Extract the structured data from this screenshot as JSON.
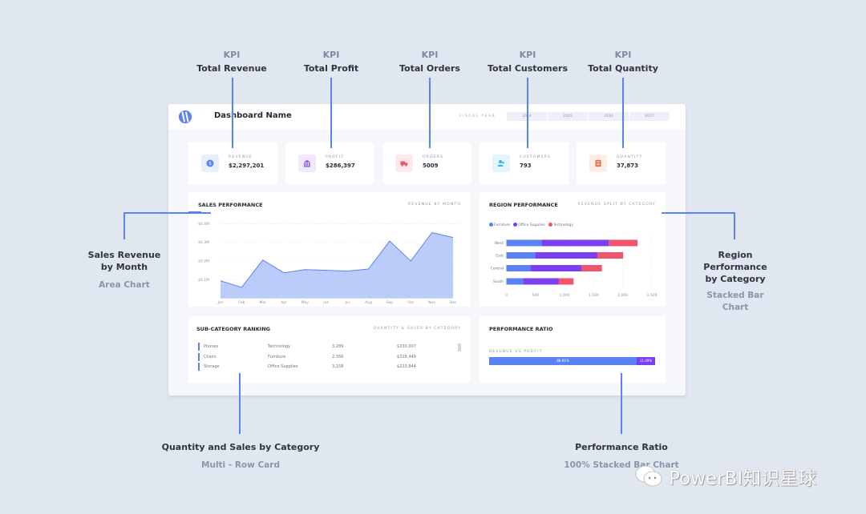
{
  "annotations": {
    "kpis": [
      {
        "tag": "KPI",
        "title": "Total Revenue"
      },
      {
        "tag": "KPI",
        "title": "Total Profit"
      },
      {
        "tag": "KPI",
        "title": "Total Orders"
      },
      {
        "tag": "KPI",
        "title": "Total Customers"
      },
      {
        "tag": "KPI",
        "title": "Total Quantity"
      }
    ],
    "sales": {
      "line1": "Sales Revenue",
      "line2": "by Month",
      "type": "Area Chart"
    },
    "region": {
      "line1": "Region",
      "line2": "Performance",
      "line3": "by Category",
      "type1": "Stacked Bar",
      "type2": "Chart"
    },
    "subcat": {
      "title": "Quantity and Sales by Category",
      "type": "Multi - Row Card"
    },
    "ratio": {
      "title": "Performance Ratio",
      "type": "100% Stacked Bar Chart"
    }
  },
  "header": {
    "dashboard_name": "Dashboard Name",
    "fiscal_year_label": "FISCAL YEAR",
    "years": [
      "2014",
      "2015",
      "2016",
      "2017"
    ]
  },
  "kpis": [
    {
      "label": "REVENUE",
      "value": "$2,297,201",
      "icon": "dollar-icon",
      "color": "#5b82f5",
      "bg": "#e8eefc"
    },
    {
      "label": "PROFIT",
      "value": "$286,397",
      "icon": "bank-icon",
      "color": "#7b3ff2",
      "bg": "#f0e9fd"
    },
    {
      "label": "ORDERS",
      "value": "5009",
      "icon": "truck-icon",
      "color": "#f2546b",
      "bg": "#fde8eb"
    },
    {
      "label": "CUSTOMERS",
      "value": "793",
      "icon": "users-icon",
      "color": "#2fb1ef",
      "bg": "#e3f5fd"
    },
    {
      "label": "QUANTITY",
      "value": "37,873",
      "icon": "box-icon",
      "color": "#e0714a",
      "bg": "#fcede7"
    }
  ],
  "sales_performance": {
    "title": "SALES PERFORMANCE",
    "subtitle": "REVENUE BY MONTH"
  },
  "region_performance": {
    "title": "REGION PERFORMANCE",
    "subtitle": "REVENUE SPLIT BY CATEGORY",
    "legend": [
      "Furniture",
      "Office Supplies",
      "Technology"
    ]
  },
  "subcategory": {
    "title": "SUB-CATEGORY RANKING",
    "subtitle": "QUANTITY & SALES BY CATEGORY",
    "rows": [
      {
        "name": "Phones",
        "category": "Technology",
        "quantity": "3,289",
        "sales": "$330,007"
      },
      {
        "name": "Chairs",
        "category": "Furniture",
        "quantity": "2,356",
        "sales": "$328,449"
      },
      {
        "name": "Storage",
        "category": "Office Supplies",
        "quantity": "3,158",
        "sales": "$223,844"
      }
    ]
  },
  "performance_ratio": {
    "title": "PERFORMANCE RATIO",
    "subtitle": "REVENUE VS PROFIT"
  },
  "watermark": "PowerBI知识星球",
  "colors": {
    "accent": "#5b82f5",
    "furniture": "#5b82f5",
    "office_supplies": "#7b3ff2",
    "technology": "#f2546b",
    "area_fill": "#b7c8fa"
  },
  "chart_data": [
    {
      "type": "area",
      "title": "SALES PERFORMANCE",
      "subtitle": "REVENUE BY MONTH",
      "categories": [
        "Jan",
        "Feb",
        "Mar",
        "Apr",
        "May",
        "Jun",
        "Jul",
        "Aug",
        "Sep",
        "Oct",
        "Nov",
        "Dec"
      ],
      "values": [
        0.094,
        0.059,
        0.205,
        0.137,
        0.154,
        0.15,
        0.146,
        0.157,
        0.307,
        0.2,
        0.352,
        0.326
      ],
      "yticks": [
        "$0.1M",
        "$0.2M",
        "$0.3M",
        "$0.4M"
      ],
      "ytick_values": [
        0.1,
        0.2,
        0.3,
        0.4
      ],
      "ylabel": "",
      "xlabel": "",
      "ylim": [
        0,
        0.4
      ],
      "grid": true
    },
    {
      "type": "bar",
      "orientation": "horizontal",
      "stacked": true,
      "title": "REGION PERFORMANCE",
      "subtitle": "REVENUE SPLIT BY CATEGORY",
      "categories": [
        "West",
        "East",
        "Central",
        "South"
      ],
      "series": [
        {
          "name": "Furniture",
          "values": [
            607,
            497,
            414,
            285
          ]
        },
        {
          "name": "Office Supplies",
          "values": [
            1154,
            1066,
            873,
            616
          ]
        },
        {
          "name": "Technology",
          "values": [
            492,
            442,
            354,
            253
          ]
        }
      ],
      "xticks": [
        "0",
        "500",
        "1,000",
        "1,500",
        "2,000",
        "2,500"
      ],
      "xtick_values": [
        0,
        500,
        1000,
        1500,
        2000,
        2500
      ],
      "xlim": [
        0,
        2500
      ],
      "legend": "top-left",
      "grid": true
    },
    {
      "type": "bar",
      "orientation": "horizontal",
      "stacked": true,
      "percent": true,
      "title": "PERFORMANCE RATIO",
      "subtitle": "REVENUE VS PROFIT",
      "categories": [
        "Revenue vs Profit"
      ],
      "series": [
        {
          "name": "Revenue",
          "values": [
            88.91
          ],
          "label": "88.91%"
        },
        {
          "name": "Profit",
          "values": [
            11.09
          ],
          "label": "11.09%"
        }
      ]
    }
  ]
}
